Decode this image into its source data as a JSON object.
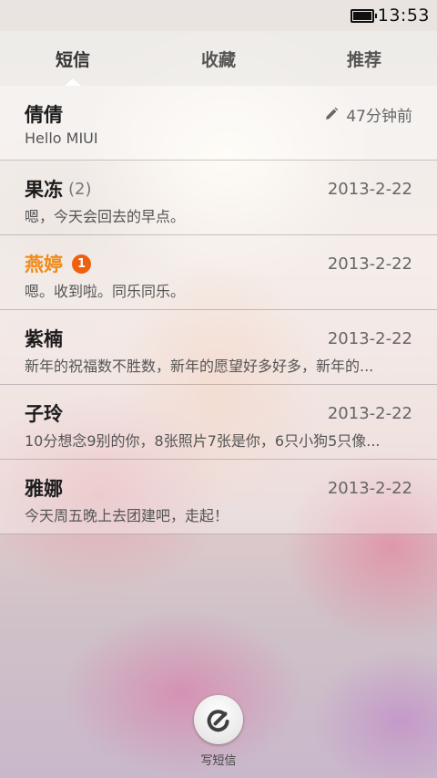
{
  "status_bar": {
    "time": "13:53"
  },
  "tabs": [
    {
      "label": "短信",
      "active": true
    },
    {
      "label": "收藏",
      "active": false
    },
    {
      "label": "推荐",
      "active": false
    }
  ],
  "conversations": [
    {
      "name": "倩倩",
      "count": "",
      "unread": "",
      "time": "47分钟前",
      "draft": true,
      "preview": "Hello MIUI"
    },
    {
      "name": "果冻",
      "count": "(2)",
      "unread": "",
      "time": "2013-2-22",
      "draft": false,
      "preview": "嗯，今天会回去的早点。"
    },
    {
      "name": "燕婷",
      "count": "",
      "unread": "1",
      "time": "2013-2-22",
      "draft": false,
      "preview": "嗯。收到啦。同乐同乐。"
    },
    {
      "name": "紫楠",
      "count": "",
      "unread": "",
      "time": "2013-2-22",
      "draft": false,
      "preview": "新年的祝福数不胜数，新年的愿望好多好多，新年的..."
    },
    {
      "name": "子玲",
      "count": "",
      "unread": "",
      "time": "2013-2-22",
      "draft": false,
      "preview": "10分想念9别的你，8张照片7张是你，6只小狗5只像..."
    },
    {
      "name": "雅娜",
      "count": "",
      "unread": "",
      "time": "2013-2-22",
      "draft": false,
      "preview": "今天周五晚上去团建吧，走起！"
    }
  ],
  "compose": {
    "label": "写短信",
    "icon": "compose-icon"
  },
  "colors": {
    "unread_name": "#f08a16",
    "unread_badge": "#f0600c"
  }
}
